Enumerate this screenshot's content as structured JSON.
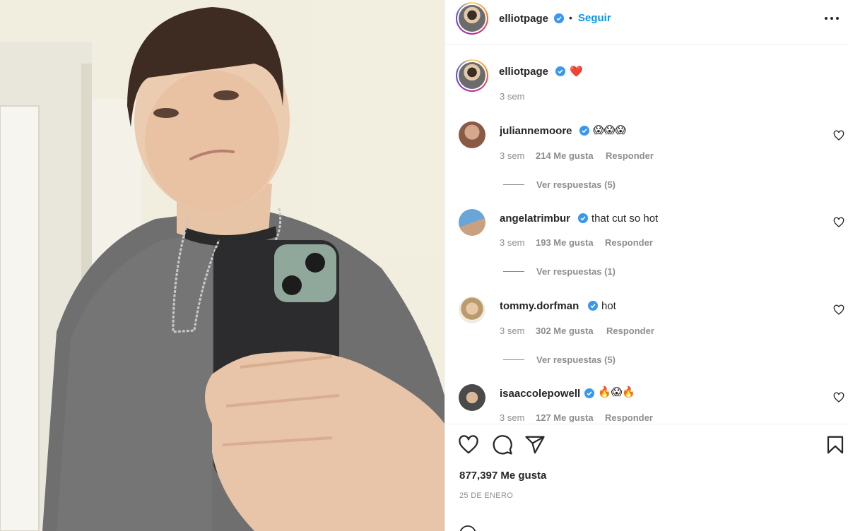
{
  "post": {
    "author": "elliotpage",
    "follow_label": "Seguir",
    "caption_emoji": "❤️",
    "caption_time": "3 sem"
  },
  "comments": [
    {
      "username": "juliannemoore",
      "text": "😱😱😱",
      "time": "3 sem",
      "likes": "214 Me gusta",
      "reply": "Responder",
      "view_replies": "Ver respuestas (5)"
    },
    {
      "username": "angelatrimbur",
      "text": "that cut so hot",
      "time": "3 sem",
      "likes": "193 Me gusta",
      "reply": "Responder",
      "view_replies": "Ver respuestas (1)"
    },
    {
      "username": "tommy.dorfman",
      "text": "hot",
      "time": "3 sem",
      "likes": "302 Me gusta",
      "reply": "Responder",
      "view_replies": "Ver respuestas (5)"
    },
    {
      "username": "isaaccolepowell",
      "text": "🔥😱🔥",
      "time": "3 sem",
      "likes": "127 Me gusta",
      "reply": "Responder"
    }
  ],
  "stats": {
    "likes": "877,397 Me gusta",
    "date": "25 DE ENERO"
  },
  "icons": {
    "like": "heart-icon",
    "comment": "comment-icon",
    "share": "share-icon",
    "save": "bookmark-icon",
    "more": "more-options-icon",
    "verified": "verified-badge-icon"
  },
  "colors": {
    "accent": "#0095f6",
    "verified": "#3897f0",
    "muted": "#8e8e8e",
    "text": "#262626"
  }
}
